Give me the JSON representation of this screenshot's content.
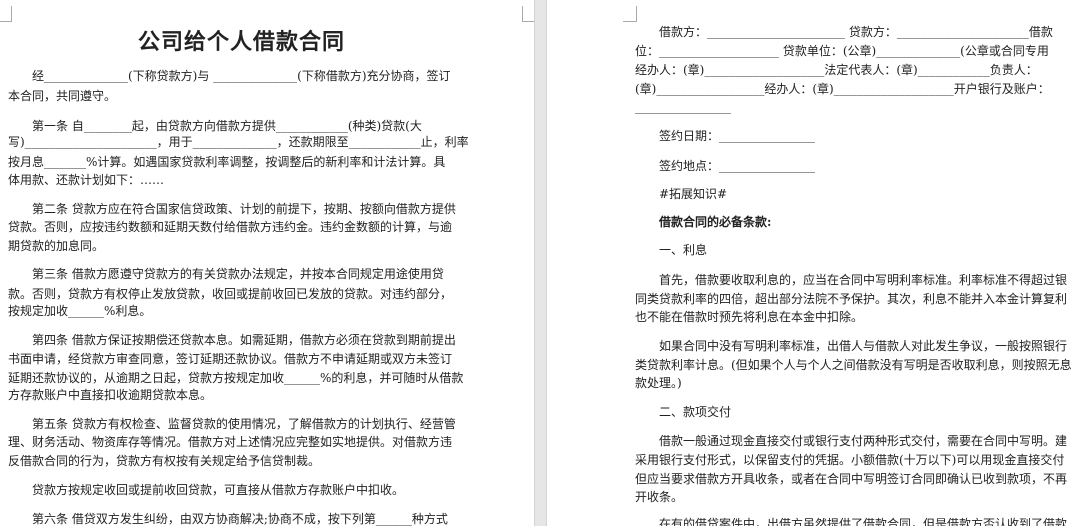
{
  "left": {
    "title": "公司给个人借款合同",
    "lines": [
      "　　经______________(下称贷款方)与 ______________(下称借款方)充分协商，签订",
      "本合同，共同遵守。",
      "　　第一条 自________起，由贷款方向借款方提供____________(种类)贷款(大",
      "写)______________________，用于______________，还款期限至____________止，利率",
      "按月息_______%计算。如遇国家贷款利率调整，按调整后的新利率和计法计算。具",
      "体用款、还款计划如下：……",
      "　　第二条 贷款方应在符合国家信贷政策、计划的前提下，按期、按额向借款方提供",
      "贷款。否则，应按违约数额和延期天数付给借款方违约金。违约金数额的计算，与逾",
      "期贷款的加息同。",
      "　　第三条 借款方愿遵守贷款方的有关贷款办法规定，并按本合同规定用途使用贷",
      "款。否则，贷款方有权停止发放贷款，收回或提前收回已发放的贷款。对违约部分，",
      "按规定加收______%利息。",
      "　　第四条 借款方保证按期偿还贷款本息。如需延期，借款方必须在贷款到期前提出",
      "书面申请，经贷款方审查同意，签订延期还款协议。借款方不申请延期或双方未签订",
      "延期还款协议的，从逾期之日起，贷款方按规定加收______%的利息，并可随时从借款",
      "方存款账户中直接扣收逾期贷款本息。",
      "　　第五条 贷款方有权检查、监督贷款的使用情况，了解借款方的计划执行、经营管",
      "理、财务活动、物资库存等情况。借款方对上述情况应完整如实地提供。对借款方违",
      "反借款合同的行为，贷款方有权按有关规定给予信贷制裁。",
      "　　贷款方按规定收回或提前收回贷款，可直接从借款方存款账户中扣收。",
      "　　第六条 借贷双方发生纠纷，由双方协商解决;协商不成，按下列第______种方式"
    ]
  },
  "right": {
    "lines": [
      "　　借款方：_______________________ 贷款方：______________________借款",
      "位：____________________ 贷款单位：(公章)______________(公章或合同专用",
      "经办人：(章)____________________法定代表人：(章)____________负责人：",
      "(章)__________________经办人：(章)____________________开户银行及账户：",
      "________________",
      "　　签约日期：________________",
      "　　签约地点：________________",
      "　　#拓展知识#",
      "　　借款合同的必备条款:",
      "　　一、利息",
      "　　首先，借款要收取利息的，应当在合同中写明利率标准。利率标准不得超过银",
      "同类贷款利率的四倍，超出部分法院不予保护。其次，利息不能并入本金计算复利",
      "也不能在借款时预先将利息在本金中扣除。",
      "　　如果合同中没有写明利率标准，出借人与借款人对此发生争议，一般按照银行",
      "类贷款利率计息。(但如果个人与个人之间借款没有写明是否收取利息，则按照无息",
      "款处理。)",
      "　　二、款项交付",
      "　　借款一般通过现金直接交付或银行支付两种形式交付，需要在合同中写明。建",
      "采用银行支付形式，以保留支付的凭据。小额借款(十万以下)可以用现金直接交付",
      "但应当要求借款方开具收条，或者在合同中写明签订合同即确认已收到款项，不再",
      "开收条。",
      "　　在有的借贷案件中，出借方虽然提供了借款合同，但是借款方否认收到了借款"
    ]
  }
}
